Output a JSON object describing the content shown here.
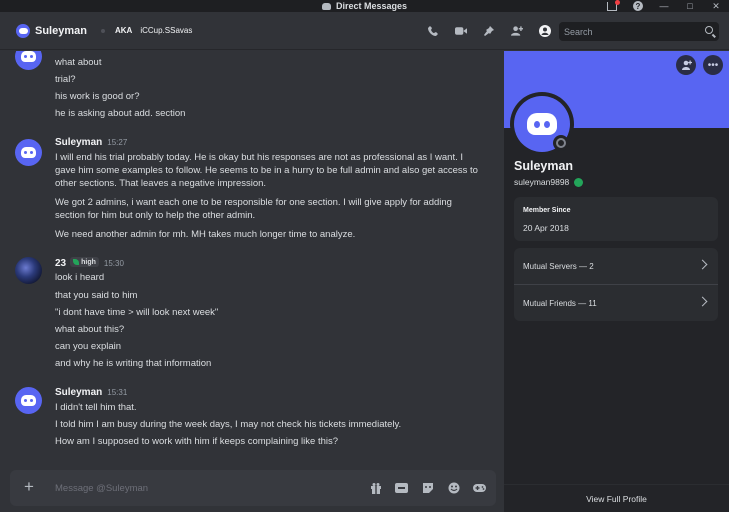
{
  "titlebar": {
    "title": "Direct Messages"
  },
  "header": {
    "name": "Suleyman",
    "aka": "AKA",
    "alias": "iCCup.SSavas",
    "search_placeholder": "Search"
  },
  "messages": {
    "top_lines": [
      "what about",
      "trial?",
      "his work is good or?",
      "he is asking about add. section"
    ],
    "group1": {
      "author": "Suleyman",
      "time": "15:27",
      "lines": [
        "I will end his trial probably today. He is okay but his responses are not as professional as I want. I gave him some examples to follow. He seems to be  in a hurry to be full admin and also get access to other sections. That leaves a negative impression.",
        "We got 2 admins, i want each one to be responsible for one section. I will give apply for adding section for him but only to help the other admin.",
        "We need another admin for mh. MH takes much longer time to analyze."
      ]
    },
    "group2": {
      "author": "23",
      "tag": "high",
      "time": "15:30",
      "lines": [
        "look i heard",
        "that you said to him",
        "\"i dont have time > will look next week\"",
        "what about this?",
        "can you explain",
        "and why he is writing that information"
      ]
    },
    "group3": {
      "author": "Suleyman",
      "time": "15:31",
      "lines": [
        "I didn't tell him that.",
        "I told him I am busy during the week days, I may not check his tickets immediately.",
        "How am I supposed to work with him if keeps complaining like this?"
      ]
    }
  },
  "composer": {
    "placeholder": "Message @Suleyman"
  },
  "profile": {
    "display_name": "Suleyman",
    "username": "suleyman9898",
    "member_since_label": "Member Since",
    "member_since_date": "20 Apr 2018",
    "mutual_servers": "Mutual Servers — 2",
    "mutual_friends": "Mutual Friends — 11",
    "view_full_profile": "View Full Profile"
  },
  "colors": {
    "blurple": "#5865f2",
    "online_green": "#23a55a",
    "background": "#313338",
    "panel": "#232428"
  }
}
